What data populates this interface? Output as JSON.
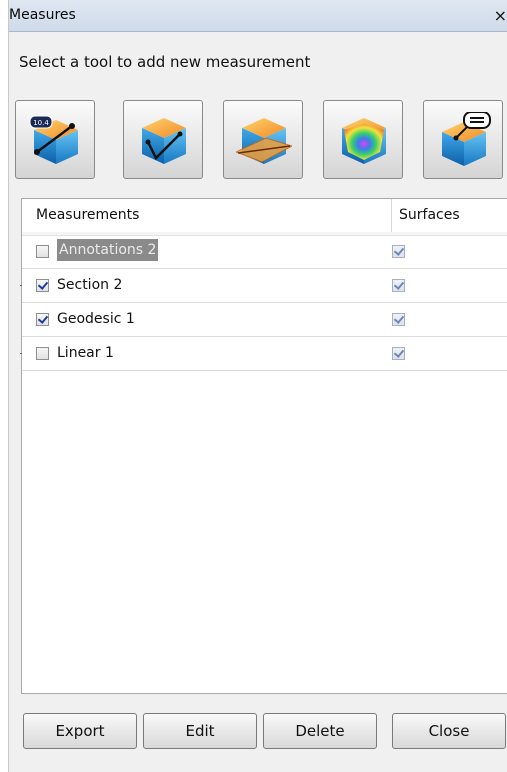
{
  "window": {
    "title": "Measures",
    "close_glyph": "×"
  },
  "hint": "Select a tool to add new measurement",
  "tools": [
    {
      "icon": "linear-measure-icon"
    },
    {
      "icon": "geodesic-measure-icon"
    },
    {
      "icon": "section-measure-icon"
    },
    {
      "icon": "heatmap-surface-icon"
    },
    {
      "icon": "annotation-measure-icon"
    }
  ],
  "table": {
    "columns": [
      "Measurements",
      "Surfaces"
    ],
    "rows": [
      {
        "label": "Annotations 2",
        "checked": false,
        "surface": true,
        "selected": true
      },
      {
        "label": "Section 2",
        "checked": true,
        "surface": true,
        "selected": false
      },
      {
        "label": "Geodesic 1",
        "checked": true,
        "surface": true,
        "selected": false
      },
      {
        "label": "Linear 1",
        "checked": false,
        "surface": true,
        "selected": false
      }
    ]
  },
  "buttons": {
    "export": "Export",
    "edit": "Edit",
    "delete": "Delete",
    "close": "Close"
  },
  "colors": {
    "accent": "#1c3d9c",
    "selection": "#8a8a8a",
    "titlebar": "#dfe7f2"
  }
}
